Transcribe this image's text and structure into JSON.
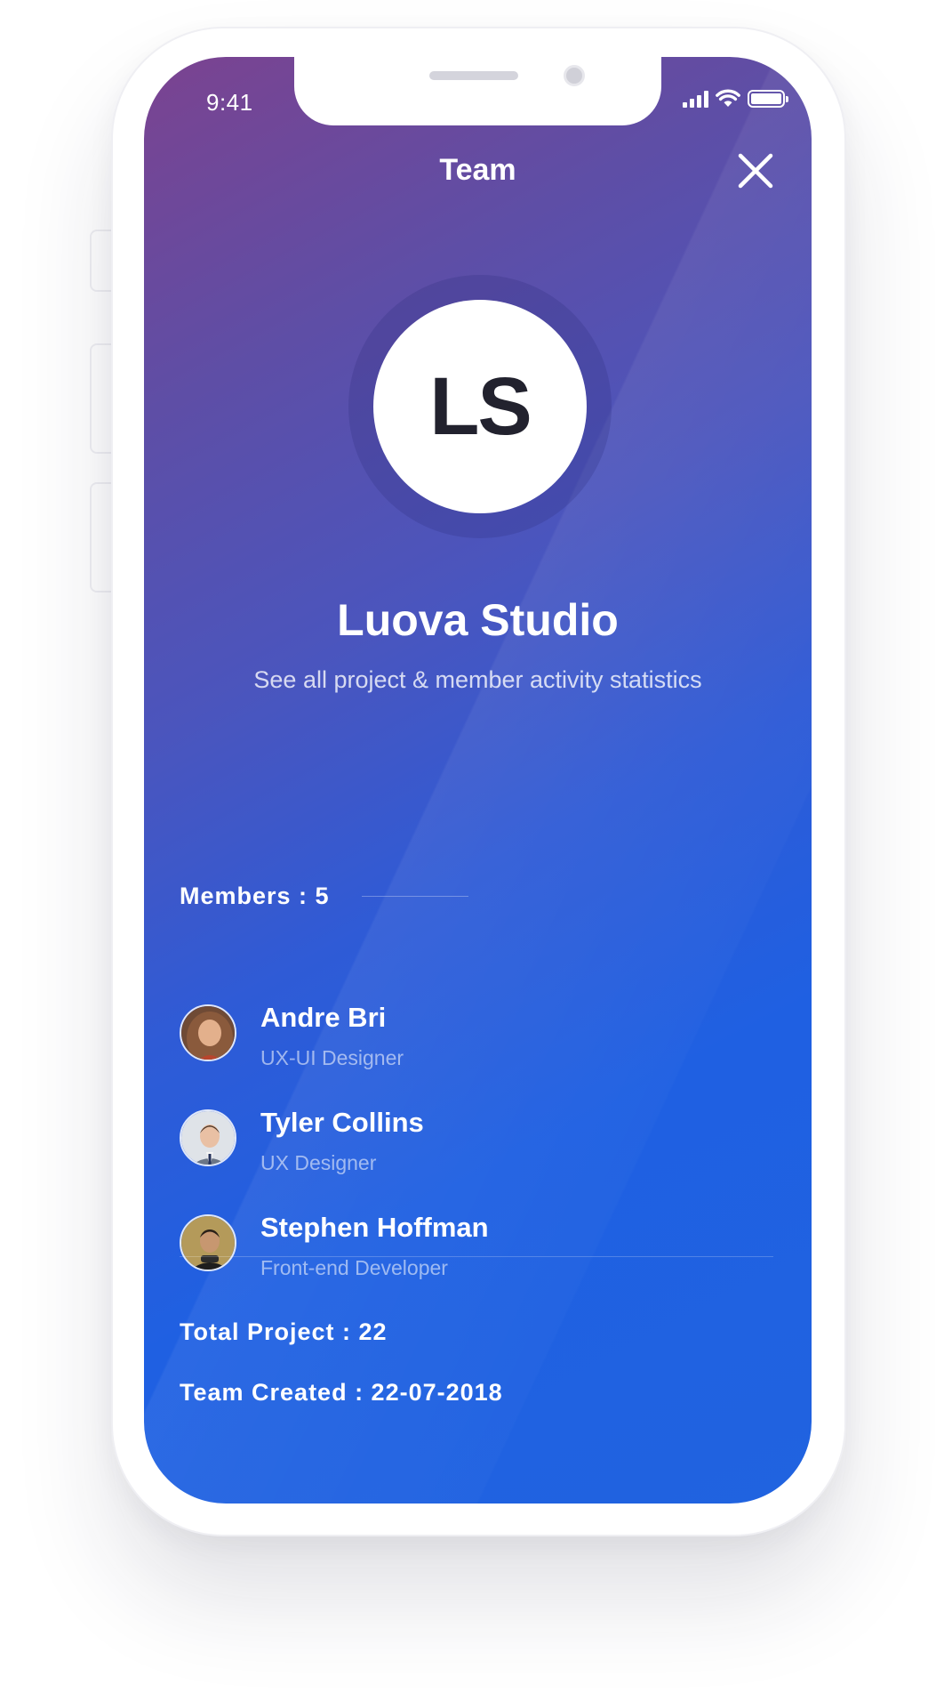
{
  "status_bar": {
    "time": "9:41",
    "icons": [
      "cellular-signal-icon",
      "wifi-icon",
      "battery-icon"
    ]
  },
  "header": {
    "title": "Team",
    "close_icon": "close-icon"
  },
  "team": {
    "initials": "LS",
    "name": "Luova Studio",
    "subtitle": "See all project & member activity statistics"
  },
  "members": {
    "heading": "Members : 5",
    "list": [
      {
        "name": "Andre Bri",
        "role": "UX-UI Designer"
      },
      {
        "name": "Tyler Collins",
        "role": "UX Designer"
      },
      {
        "name": "Stephen Hoffman",
        "role": "Front-end Developer"
      }
    ]
  },
  "stats": {
    "total_project": "Total Project : 22",
    "team_created": "Team Created : 22-07-2018"
  },
  "colors": {
    "gradient_top": "#7b4390",
    "gradient_bottom": "#1f60e2",
    "text_primary": "#ffffff",
    "avatar_text": "#22222e"
  }
}
